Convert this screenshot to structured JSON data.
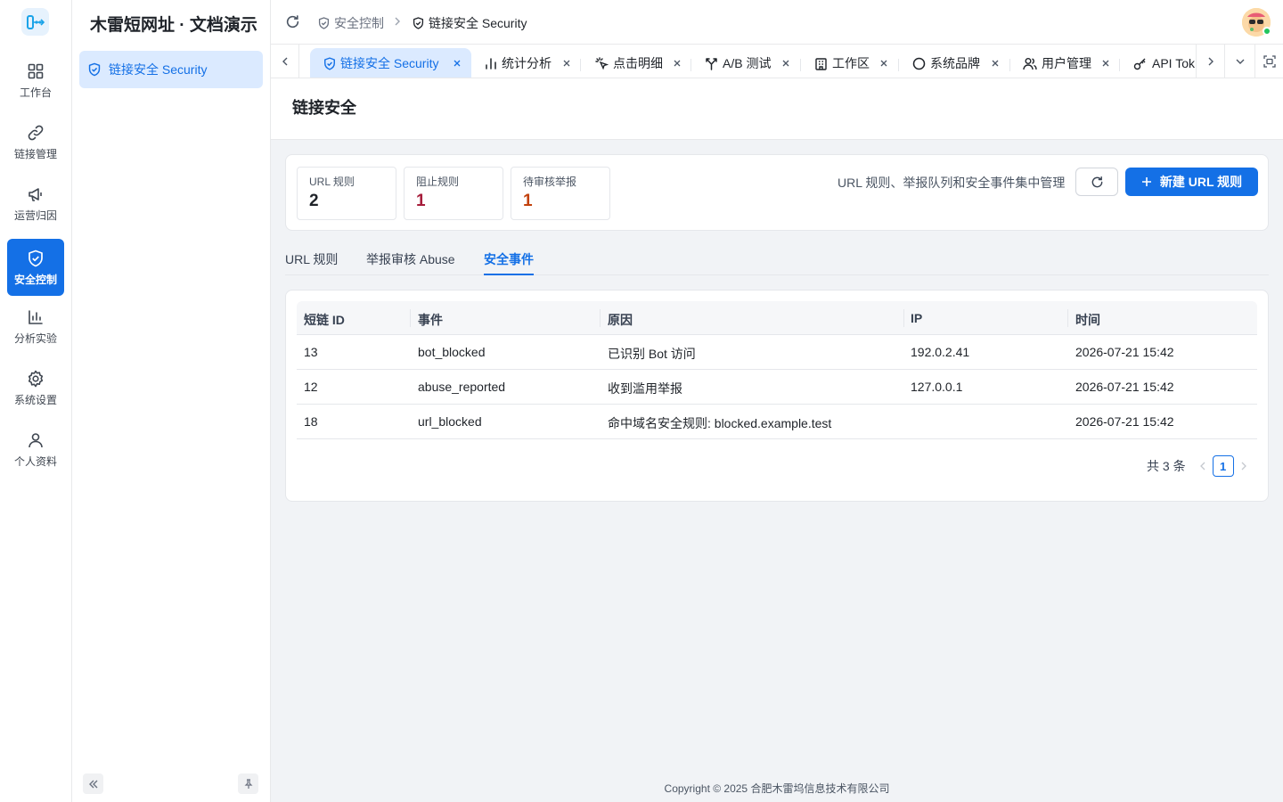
{
  "rail": {
    "items": [
      {
        "label": "工作台",
        "icon": "dashboard-icon"
      },
      {
        "label": "链接管理",
        "icon": "link-icon"
      },
      {
        "label": "运营归因",
        "icon": "megaphone-icon"
      },
      {
        "label": "安全控制",
        "icon": "shield-check-icon",
        "active": true
      },
      {
        "label": "分析实验",
        "icon": "bar-chart-icon"
      },
      {
        "label": "系统设置",
        "icon": "gear-icon"
      },
      {
        "label": "个人资料",
        "icon": "user-icon"
      }
    ]
  },
  "sidebar": {
    "brand": "木雷短网址 · 文档演示",
    "items": [
      {
        "label": "链接安全 Security",
        "icon": "shield-check-icon"
      }
    ]
  },
  "header": {
    "breadcrumb": [
      {
        "label": "安全控制",
        "icon": "shield-check-icon"
      },
      {
        "label": "链接安全 Security",
        "icon": "shield-check-icon"
      }
    ]
  },
  "tabs": [
    {
      "label": "链接安全 Security",
      "icon": "shield-check-icon",
      "active": true
    },
    {
      "label": "统计分析",
      "icon": "bar-chart-icon"
    },
    {
      "label": "点击明细",
      "icon": "click-icon"
    },
    {
      "label": "A/B 测试",
      "icon": "split-icon"
    },
    {
      "label": "工作区",
      "icon": "building-icon"
    },
    {
      "label": "系统品牌",
      "icon": "circle-icon"
    },
    {
      "label": "用户管理",
      "icon": "users-icon"
    },
    {
      "label": "API Tok",
      "icon": "key-icon"
    }
  ],
  "page": {
    "title": "链接安全"
  },
  "stats": [
    {
      "title": "URL 规则",
      "value": "2",
      "color": "#1f2329"
    },
    {
      "title": "阻止规则",
      "value": "1",
      "color": "#a61d3b"
    },
    {
      "title": "待审核举报",
      "value": "1",
      "color": "#c2410c"
    }
  ],
  "toolbar": {
    "description": "URL 规则、举报队列和安全事件集中管理",
    "new_rule_label": "新建 URL 规则"
  },
  "content_tabs": [
    {
      "label": "URL 规则"
    },
    {
      "label": "举报审核 Abuse"
    },
    {
      "label": "安全事件",
      "active": true
    }
  ],
  "table": {
    "columns": [
      "短链 ID",
      "事件",
      "原因",
      "IP",
      "时间"
    ],
    "rows": [
      [
        "13",
        "bot_blocked",
        "已识别 Bot 访问",
        "192.0.2.41",
        "2026-07-21 15:42"
      ],
      [
        "12",
        "abuse_reported",
        "收到滥用举报",
        "127.0.0.1",
        "2026-07-21 15:42"
      ],
      [
        "18",
        "url_blocked",
        "命中域名安全规则: blocked.example.test",
        "",
        "2026-07-21 15:42"
      ]
    ]
  },
  "pagination": {
    "total_text": "共 3 条",
    "current_page": "1"
  },
  "footer": {
    "copyright": "Copyright © 2025 合肥木雷坞信息技术有限公司"
  },
  "colors": {
    "accent": "#1470e6",
    "active_bg": "#dbeaff"
  }
}
